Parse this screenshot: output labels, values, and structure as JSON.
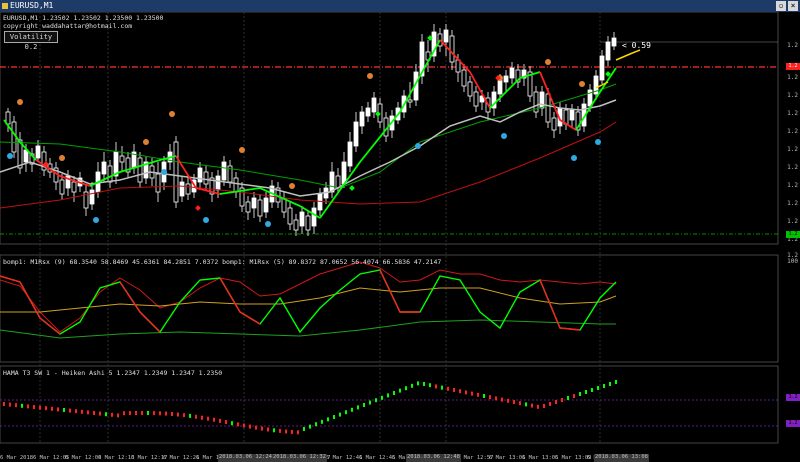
{
  "window": {
    "title": "EURUSD,M1",
    "restore": "▫",
    "close": "×",
    "icon": "chart-icon"
  },
  "main": {
    "quote": "EURUSD,M1  1.23502 1.23502 1.23500 1.23500",
    "copyright": "copyright waddahattar@hotmail.com",
    "volatility_button": "Volatility 0.2",
    "callout": "< 0.59",
    "price_labels": [
      "1.2",
      "1.2",
      "1.2",
      "1.2",
      "1.2",
      "1.2",
      "1.2",
      "1.2",
      "1.2",
      "1.2",
      "1.2",
      "1.2"
    ],
    "current_price_tag": "1.2",
    "green_level_tag": "1.2"
  },
  "indicator1": {
    "label": "bomp1: M1Rsx (9) 68.3540 58.8469 45.6361 84.2851 7.0372  bomp1: M1Rsx (5) 89.8372 87.0652 56.4074 66.5836 47.2147",
    "axis": [
      "100",
      "",
      "",
      "",
      "",
      "",
      "",
      "",
      "0"
    ]
  },
  "indicator2": {
    "label": "HAMA T3 SW 1 - Heiken Ashi 5 1.2347 1.2349 1.2347 1.2350",
    "axis": [
      "1.2",
      "1.2",
      "1.2"
    ]
  },
  "time_axis": {
    "labels": [
      "6 Mar 2018",
      "6 Mar 12:05",
      "6 Mar 12:09",
      "6 Mar 12:13",
      "6 Mar 12:17",
      "6 Mar 12:21",
      "6 Mar 12:25",
      "6 Mar 12:29",
      "6 Mar 12:33",
      "6 Mar 12:37",
      "6 Mar 12:41",
      "6 Mar 12:45",
      "6 Mar 12:49",
      "6 Mar 12:53",
      "6 Mar 12:57",
      "6 Mar 13:01",
      "6 Mar 13:05",
      "6 Mar 13:09",
      "6 Mar 13:13"
    ],
    "highlighted": [
      "2018.03.06 12:24",
      "2018.03.06 12:32",
      "2018.03.06 12:48",
      "2018.03.06 13:08"
    ]
  },
  "colors": {
    "bull": "#00ff00",
    "bear": "#ff2020",
    "grid": "#3a3a3a",
    "level": "#ff3030",
    "ma_slow": "#c01010",
    "ma_mid": "#c0c0c0",
    "ma_green": "#00a000"
  }
}
